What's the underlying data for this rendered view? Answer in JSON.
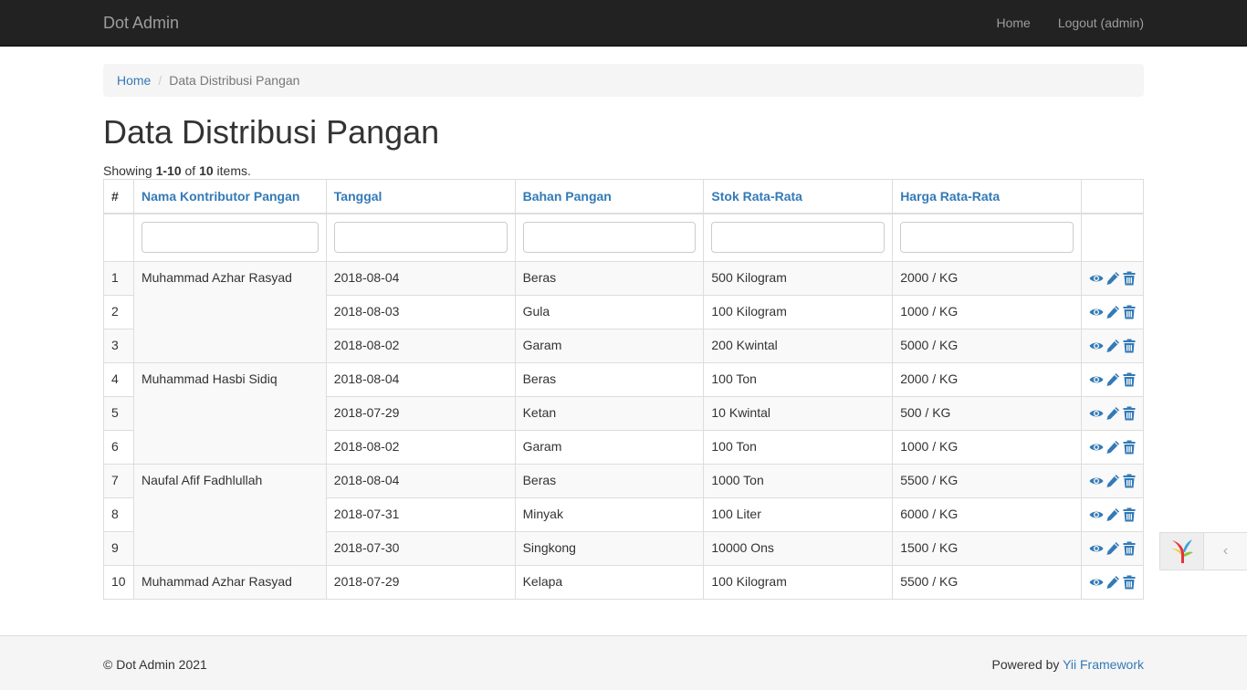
{
  "navbar": {
    "brand": "Dot Admin",
    "items": [
      "Home",
      "Logout (admin)"
    ]
  },
  "breadcrumb": {
    "home": "Home",
    "current": "Data Distribusi Pangan"
  },
  "page_title": "Data Distribusi Pangan",
  "summary": {
    "prefix": "Showing ",
    "range": "1-10",
    "mid": " of ",
    "total": "10",
    "suffix": " items."
  },
  "table": {
    "columns": [
      "#",
      "Nama Kontributor Pangan",
      "Tanggal",
      "Bahan Pangan",
      "Stok Rata-Rata",
      "Harga Rata-Rata"
    ],
    "groups": [
      {
        "contributor": "Muhammad Azhar Rasyad",
        "rows": [
          {
            "no": "1",
            "tanggal": "2018-08-04",
            "bahan": "Beras",
            "stok": "500 Kilogram",
            "harga": "2000 / KG"
          },
          {
            "no": "2",
            "tanggal": "2018-08-03",
            "bahan": "Gula",
            "stok": "100 Kilogram",
            "harga": "1000 / KG"
          },
          {
            "no": "3",
            "tanggal": "2018-08-02",
            "bahan": "Garam",
            "stok": "200 Kwintal",
            "harga": "5000 / KG"
          }
        ]
      },
      {
        "contributor": "Muhammad Hasbi Sidiq",
        "rows": [
          {
            "no": "4",
            "tanggal": "2018-08-04",
            "bahan": "Beras",
            "stok": "100 Ton",
            "harga": "2000 / KG"
          },
          {
            "no": "5",
            "tanggal": "2018-07-29",
            "bahan": "Ketan",
            "stok": "10 Kwintal",
            "harga": "500 / KG"
          },
          {
            "no": "6",
            "tanggal": "2018-08-02",
            "bahan": "Garam",
            "stok": "100 Ton",
            "harga": "1000 / KG"
          }
        ]
      },
      {
        "contributor": "Naufal Afif Fadhlullah",
        "rows": [
          {
            "no": "7",
            "tanggal": "2018-08-04",
            "bahan": "Beras",
            "stok": "1000 Ton",
            "harga": "5500 / KG"
          },
          {
            "no": "8",
            "tanggal": "2018-07-31",
            "bahan": "Minyak",
            "stok": "100 Liter",
            "harga": "6000 / KG"
          },
          {
            "no": "9",
            "tanggal": "2018-07-30",
            "bahan": "Singkong",
            "stok": "10000 Ons",
            "harga": "1500 / KG"
          }
        ]
      },
      {
        "contributor": "Muhammad Azhar Rasyad",
        "rows": [
          {
            "no": "10",
            "tanggal": "2018-07-29",
            "bahan": "Kelapa",
            "stok": "100 Kilogram",
            "harga": "5500 / KG"
          }
        ]
      }
    ]
  },
  "footer": {
    "copyright": "© Dot Admin 2021",
    "powered_prefix": "Powered by ",
    "powered_link": "Yii Framework"
  },
  "debug_toolbar": {
    "toggle_glyph": "‹"
  },
  "colors": {
    "link": "#337ab7",
    "navbar": "#222222"
  }
}
